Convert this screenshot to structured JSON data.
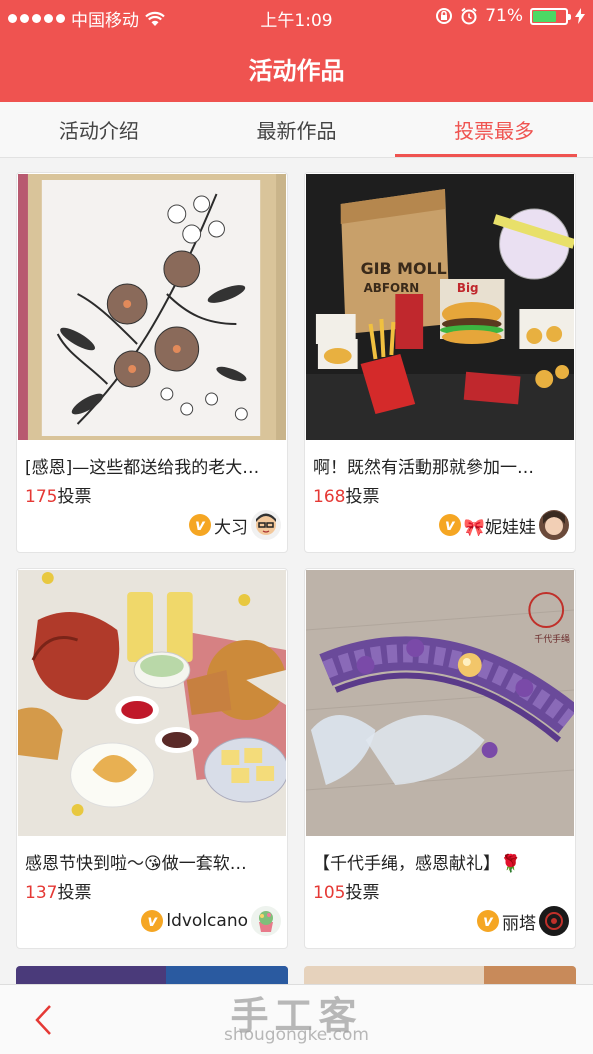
{
  "status": {
    "carrier": "中国移动",
    "time": "上午1:09",
    "battery": "71%",
    "battery_level": 0.71
  },
  "header": {
    "title": "活动作品"
  },
  "tabs": [
    {
      "label": "活动介绍",
      "active": false
    },
    {
      "label": "最新作品",
      "active": false
    },
    {
      "label": "投票最多",
      "active": true
    }
  ],
  "vote_suffix": "投票",
  "cards": [
    {
      "title": "[感恩]—这些都送给我的老大…",
      "votes": "175",
      "author": "大习",
      "badge": "v"
    },
    {
      "title": "啊！既然有活動那就參加一…",
      "votes": "168",
      "author": "🎀妮娃娃",
      "badge": "v"
    },
    {
      "title": "感恩节快到啦～😘做一套软…",
      "votes": "137",
      "author": "ldvolcano",
      "badge": "v"
    },
    {
      "title": "【千代手绳，感恩献礼】🌹",
      "votes": "105",
      "author": "丽塔",
      "badge": "v"
    }
  ],
  "images": {
    "card2_bag_text": "GIB MOLL",
    "card2_bag_text2": "ABFORN",
    "card2_box_text": "Big",
    "card4_logo_text": "千代手绳"
  },
  "watermark": {
    "cn": "手工客",
    "en": "shougongke.com"
  },
  "icons": {
    "back": "chevron-left-icon",
    "wifi": "wifi-icon",
    "lock": "rotation-lock-icon",
    "alarm": "alarm-icon",
    "charge": "charging-icon"
  }
}
